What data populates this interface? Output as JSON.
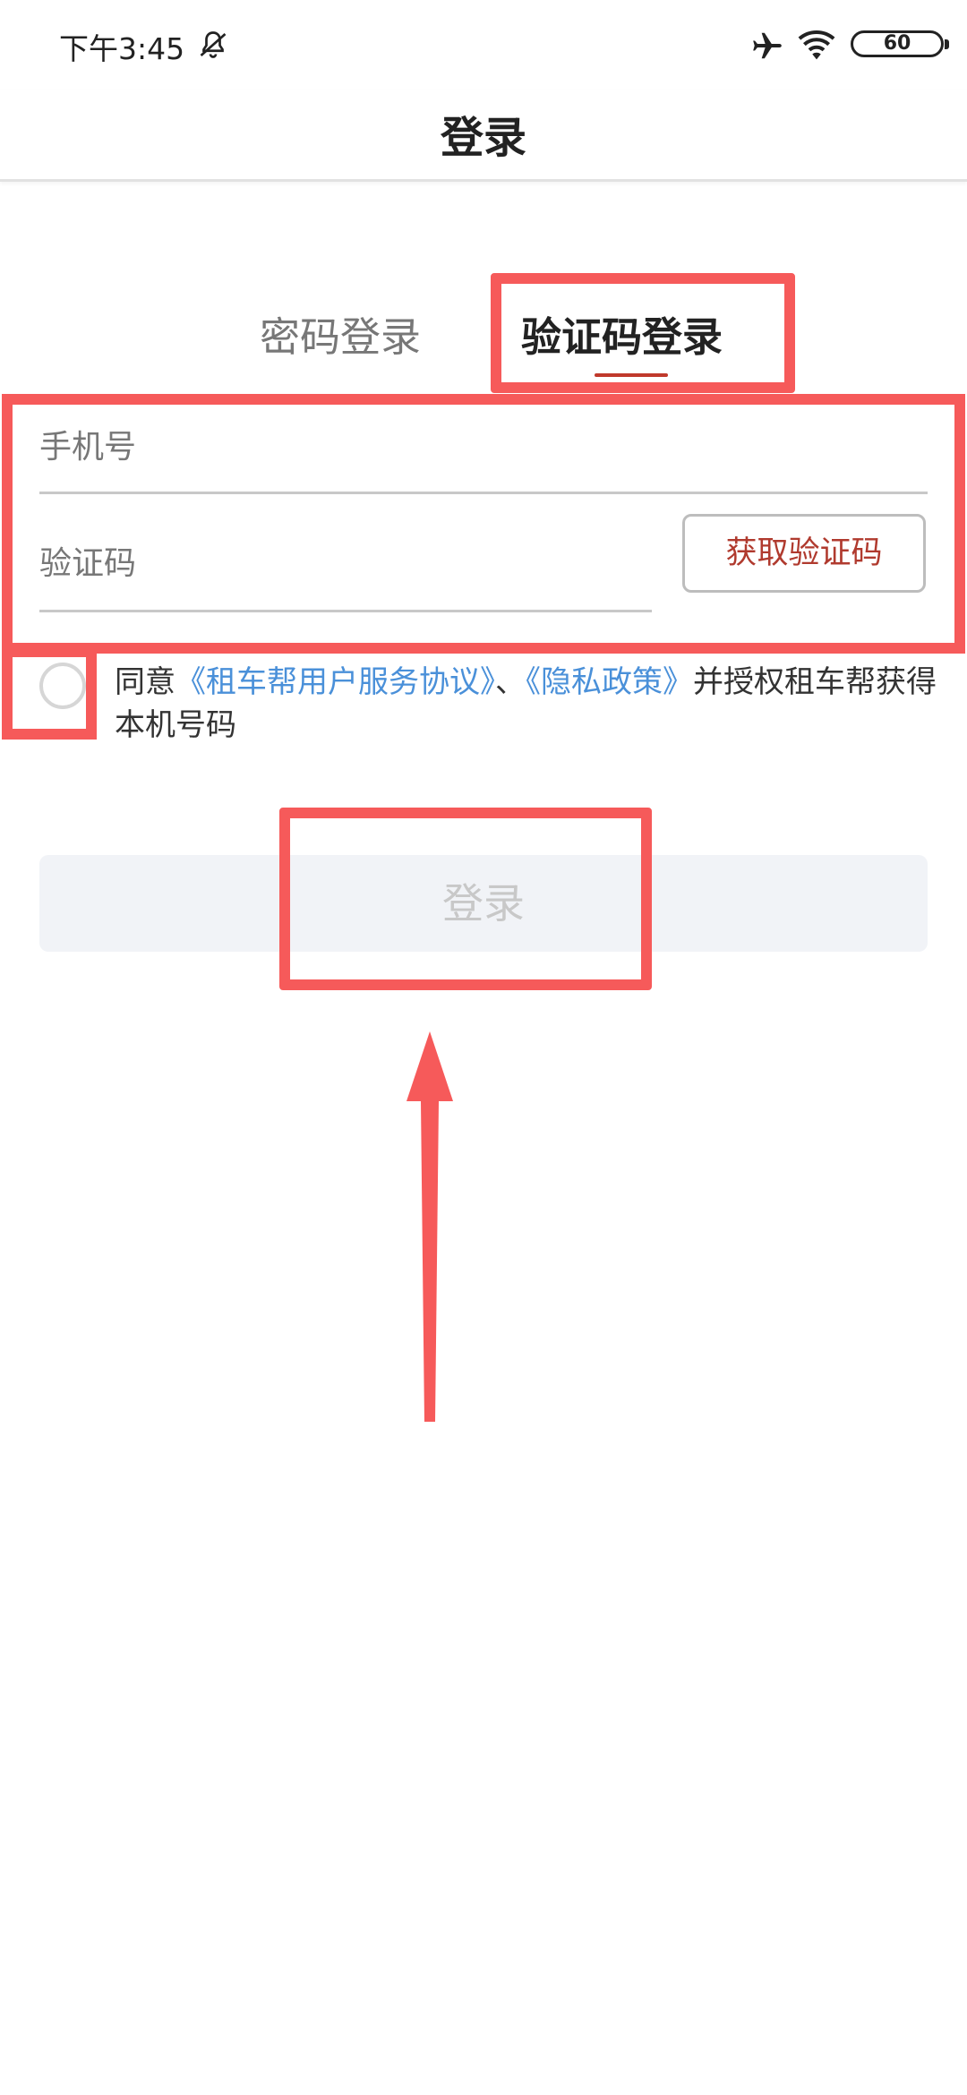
{
  "status_bar": {
    "time": "下午3:45",
    "icons": [
      "bell-off-icon",
      "airplane-icon",
      "wifi-icon",
      "battery-icon"
    ],
    "battery_level": "60"
  },
  "header": {
    "title": "登录"
  },
  "tabs": [
    {
      "label": "密码登录",
      "active": false
    },
    {
      "label": "验证码登录",
      "active": true
    }
  ],
  "form": {
    "phone_placeholder": "手机号",
    "code_placeholder": "验证码",
    "get_code_label": "获取验证码"
  },
  "agreement": {
    "prefix": "同意",
    "link_terms": "《租车帮用户服务协议》",
    "separator": "、",
    "link_privacy": "《隐私政策》",
    "suffix": "并授权租车帮获得本机号码",
    "checked": false
  },
  "login_button": {
    "label": "登录",
    "enabled": false
  },
  "colors": {
    "accent_red": "#b03a2e",
    "link_blue": "#4a90d9",
    "annotation_red": "#f65a5a",
    "disabled_button_bg": "#f1f3f7"
  }
}
